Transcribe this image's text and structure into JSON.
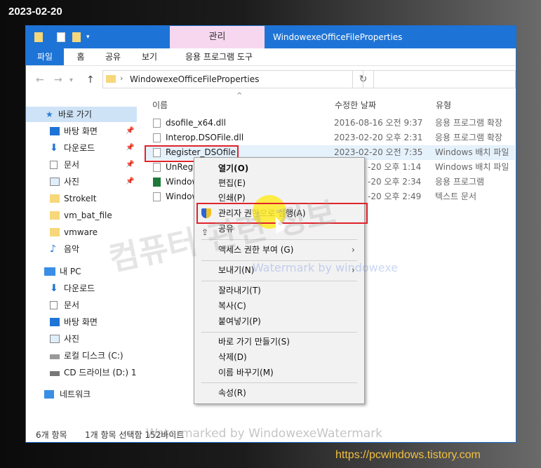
{
  "date_stamp": "2023-02-20",
  "site_url": "https://pcwindows.tistory.com",
  "titlebar": {
    "context_tab": "관리",
    "title": "WindowexeOfficeFileProperties"
  },
  "ribbon_tabs": [
    "파일",
    "홈",
    "공유",
    "보기",
    "응용 프로그램 도구"
  ],
  "address": {
    "path": "WindowexeOfficeFileProperties",
    "separator": "›"
  },
  "columns": {
    "name": "이름",
    "date": "수정한 날짜",
    "type": "유형"
  },
  "nav": {
    "quick_access": "바로 가기",
    "items": [
      {
        "label": "바탕 화면",
        "icon": "desktop-icon",
        "pinned": true
      },
      {
        "label": "다운로드",
        "icon": "download-icon",
        "pinned": true
      },
      {
        "label": "문서",
        "icon": "document-icon",
        "pinned": true
      },
      {
        "label": "사진",
        "icon": "pictures-icon",
        "pinned": true
      },
      {
        "label": "StrokeIt",
        "icon": "folder-icon",
        "pinned": false
      },
      {
        "label": "vm_bat_file",
        "icon": "folder-icon",
        "pinned": false
      },
      {
        "label": "vmware",
        "icon": "folder-icon",
        "pinned": false
      },
      {
        "label": "음악",
        "icon": "music-icon",
        "pinned": false
      }
    ],
    "this_pc": "내 PC",
    "pc_items": [
      {
        "label": "다운로드",
        "icon": "download-icon"
      },
      {
        "label": "문서",
        "icon": "document-icon"
      },
      {
        "label": "바탕 화면",
        "icon": "desktop-icon"
      },
      {
        "label": "사진",
        "icon": "pictures-icon"
      },
      {
        "label": "로컬 디스크 (C:)",
        "icon": "drive-icon"
      },
      {
        "label": "CD 드라이브 (D:) 1",
        "icon": "cd-drive-icon"
      }
    ],
    "network": "네트워크"
  },
  "files": [
    {
      "name": "dsofile_x64.dll",
      "date": "2016-08-16 오전 9:37",
      "type": "응용 프로그램 확장"
    },
    {
      "name": "Interop.DSOFile.dll",
      "date": "2023-02-20 오후 2:31",
      "type": "응용 프로그램 확장"
    },
    {
      "name": "Register_DSOfile",
      "date": "2023-02-20 오전 7:35",
      "type": "Windows 배치 파일"
    },
    {
      "name": "UnRegis",
      "date": "-20 오후 1:14",
      "type": "Windows 배치 파일"
    },
    {
      "name": "Window",
      "date": "-20 오후 2:34",
      "type": "응용 프로그램"
    },
    {
      "name": "Window",
      "date": "-20 오후 2:49",
      "type": "텍스트 문서"
    }
  ],
  "context_menu": {
    "open": "열기(O)",
    "edit": "편집(E)",
    "print": "인쇄(P)",
    "run_as_admin": "관리자 권한으로 실행(A)",
    "share": "공유",
    "give_access": "액세스 권한 부여 (G)",
    "send_to": "보내기(N)",
    "cut": "잘라내기(T)",
    "copy": "복사(C)",
    "paste": "붙여넣기(P)",
    "create_shortcut": "바로 가기 만들기(S)",
    "delete": "삭제(D)",
    "rename": "이름 바꾸기(M)",
    "properties": "속성(R)"
  },
  "status": {
    "count": "6개 항목",
    "selected": "1개 항목 선택함 152바이트"
  },
  "watermarks": {
    "korean": "컴퓨터 관련 정보",
    "line1": "Watermark by windowexe",
    "line2": "Watermarked by WindowexeWatermark"
  },
  "colors": {
    "accent": "#1e74d6",
    "highlight_red": "#e0242c",
    "context_tab_bg": "#f7d7f0",
    "url_color": "#f0c040"
  }
}
